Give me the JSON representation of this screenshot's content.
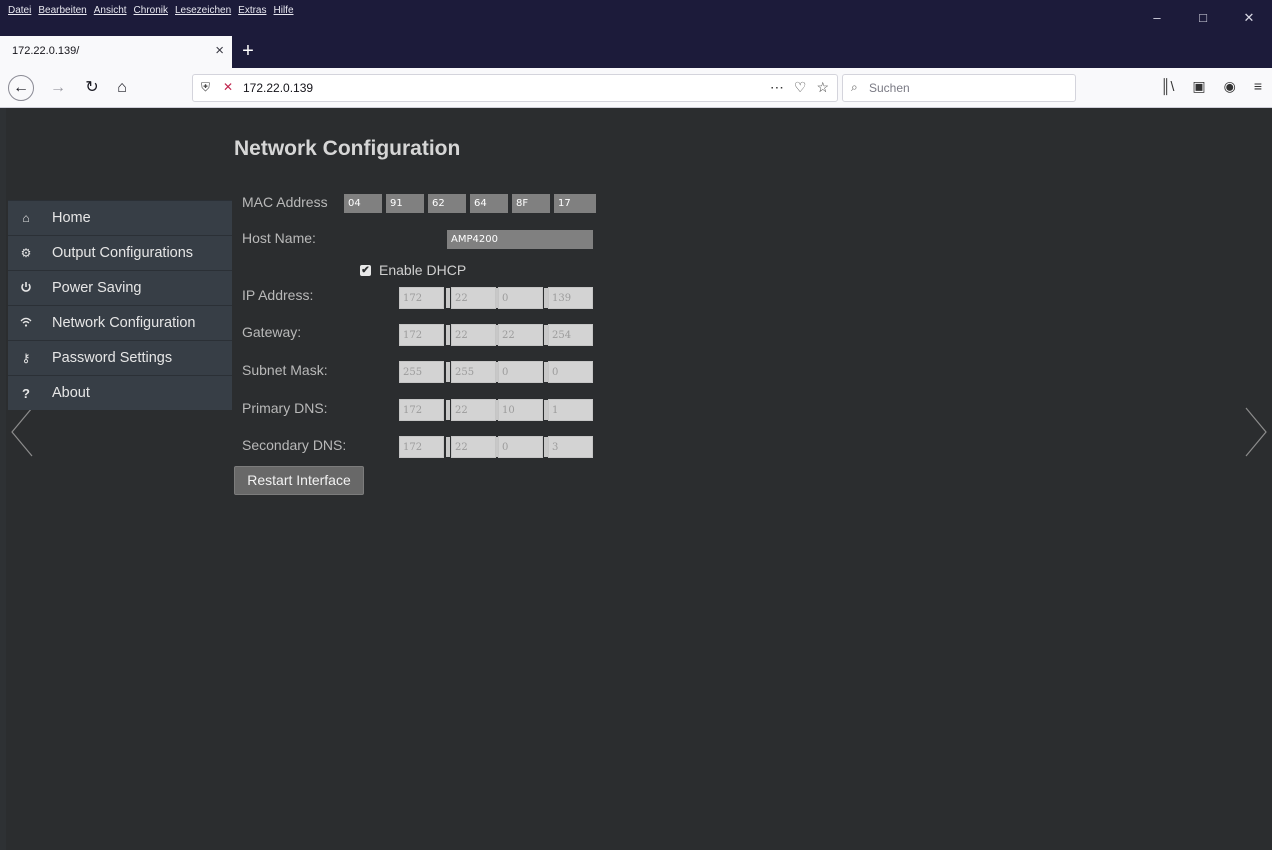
{
  "browser": {
    "menu": [
      "Datei",
      "Bearbeiten",
      "Ansicht",
      "Chronik",
      "Lesezeichen",
      "Extras",
      "Hilfe"
    ],
    "tab_title": "172.22.0.139/",
    "url": "172.22.0.139",
    "search_placeholder": "Suchen"
  },
  "page": {
    "title": "Network Configuration",
    "sidebar": [
      {
        "label": "Home",
        "icon": "home-icon"
      },
      {
        "label": "Output Configurations",
        "icon": "gear-icon"
      },
      {
        "label": "Power Saving",
        "icon": "power-icon"
      },
      {
        "label": "Network Configuration",
        "icon": "wifi-icon"
      },
      {
        "label": "Password Settings",
        "icon": "key-icon"
      },
      {
        "label": "About",
        "icon": "question-icon"
      }
    ],
    "form": {
      "mac_label": "MAC Address",
      "mac": [
        "04",
        "91",
        "62",
        "64",
        "8F",
        "17"
      ],
      "host_label": "Host Name:",
      "host": "AMP4200",
      "dhcp_label": "Enable DHCP",
      "dhcp_checked": true,
      "ip_label": "IP Address:",
      "ip": [
        "172",
        "22",
        "0",
        "139"
      ],
      "gateway_label": "Gateway:",
      "gateway": [
        "172",
        "22",
        "22",
        "254"
      ],
      "subnet_label": "Subnet Mask:",
      "subnet": [
        "255",
        "255",
        "0",
        "0"
      ],
      "pdns_label": "Primary DNS:",
      "pdns": [
        "172",
        "22",
        "10",
        "1"
      ],
      "sdns_label": "Secondary DNS:",
      "sdns": [
        "172",
        "22",
        "0",
        "3"
      ],
      "restart_label": "Restart Interface"
    }
  },
  "colors": {
    "page_bg": "#2b2d2f",
    "sidebar_bg": "#373e46",
    "field_dark": "#808080",
    "field_light": "#d3d3d3",
    "chrome_dark": "#1c1b3a"
  }
}
